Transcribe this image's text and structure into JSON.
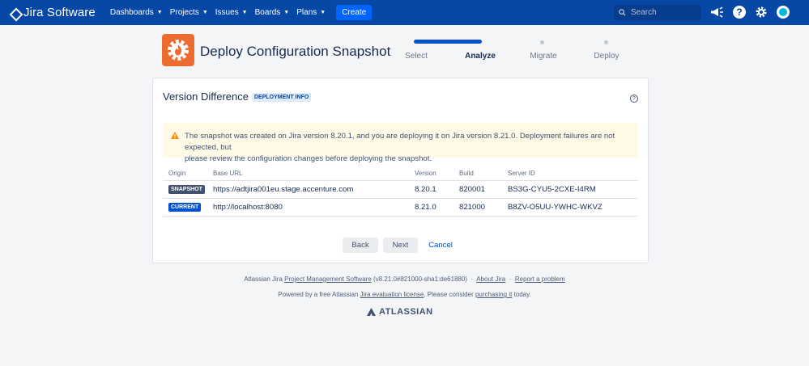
{
  "topnav": {
    "product_name": "Jira Software",
    "menu": [
      {
        "label": "Dashboards"
      },
      {
        "label": "Projects"
      },
      {
        "label": "Issues"
      },
      {
        "label": "Boards"
      },
      {
        "label": "Plans"
      }
    ],
    "create_label": "Create",
    "search_placeholder": "Search",
    "icons": [
      "notifications-icon",
      "help-icon",
      "settings-icon",
      "avatar"
    ],
    "bg_color": "#0747a6"
  },
  "header": {
    "title": "Deploy Configuration Snapshot",
    "steps": [
      {
        "label": "Select",
        "state": "done"
      },
      {
        "label": "Analyze",
        "state": "active"
      },
      {
        "label": "Migrate",
        "state": "pending"
      },
      {
        "label": "Deploy",
        "state": "pending"
      }
    ]
  },
  "panel": {
    "title": "Version Difference",
    "lozenge": "DEPLOYMENT INFO",
    "warning_line1": "The snapshot was created on Jira version 8.20.1, and you are deploying it on Jira version 8.21.0. Deployment failures are not expected, but",
    "warning_line2": "please review the configuration changes before deploying the snapshot.",
    "columns": {
      "origin": "Origin",
      "base_url": "Base URL",
      "version": "Version",
      "build": "Build",
      "server_id": "Server ID"
    },
    "rows": [
      {
        "origin": "SNAPSHOT",
        "base_url": "https://adtjira001eu.stage.accenture.com",
        "version": "8.20.1",
        "build": "820001",
        "server_id": "BS3G-CYU5-2CXE-I4RM"
      },
      {
        "origin": "CURRENT",
        "base_url": "http://localhost:8080",
        "version": "8.21.0",
        "build": "821000",
        "server_id": "B8ZV-O5UU-YWHC-WKVZ"
      }
    ],
    "back_label": "Back",
    "next_label": "Next",
    "cancel_label": "Cancel"
  },
  "footer": {
    "line1_prefix": "Atlassian Jira",
    "line1_link1": "Project Management Software",
    "line1_version": "(v8.21.0#821000-sha1:de61880)",
    "line1_sep": "·",
    "line1_link2": "About Jira",
    "line1_link3": "Report a problem",
    "line2_prefix": "Powered by a free Atlassian",
    "line2_link1": "Jira evaluation license",
    "line2_mid": ". Please consider",
    "line2_link2": "purchasing it",
    "line2_suffix": "today.",
    "brand": "ATLASSIAN"
  }
}
